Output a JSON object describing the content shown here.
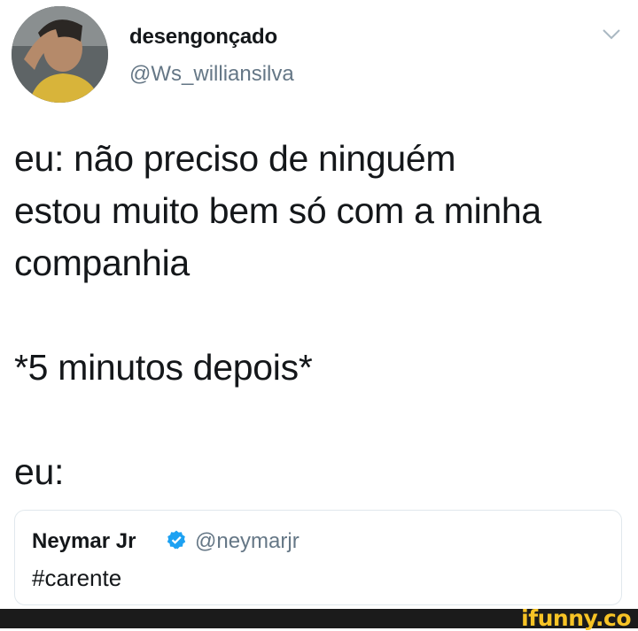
{
  "tweet": {
    "author": {
      "display_name": "desengonçado",
      "handle": "@Ws_williansilva",
      "avatar_icon": "user-photo-icon"
    },
    "menu_icon": "chevron-down-icon",
    "text_lines": [
      "eu: não preciso de ninguém",
      "estou muito bem só com a minha",
      "companhia",
      "",
      "*5 minutos depois*",
      "",
      "eu:"
    ]
  },
  "quoted_tweet": {
    "display_name": "Neymar Jr",
    "verified_icon": "verified-badge-icon",
    "verified_color": "#1da1f2",
    "handle": "@neymarjr",
    "text": "#carente"
  },
  "watermark": {
    "text": "ifunny.co",
    "color": "#f7c325"
  }
}
